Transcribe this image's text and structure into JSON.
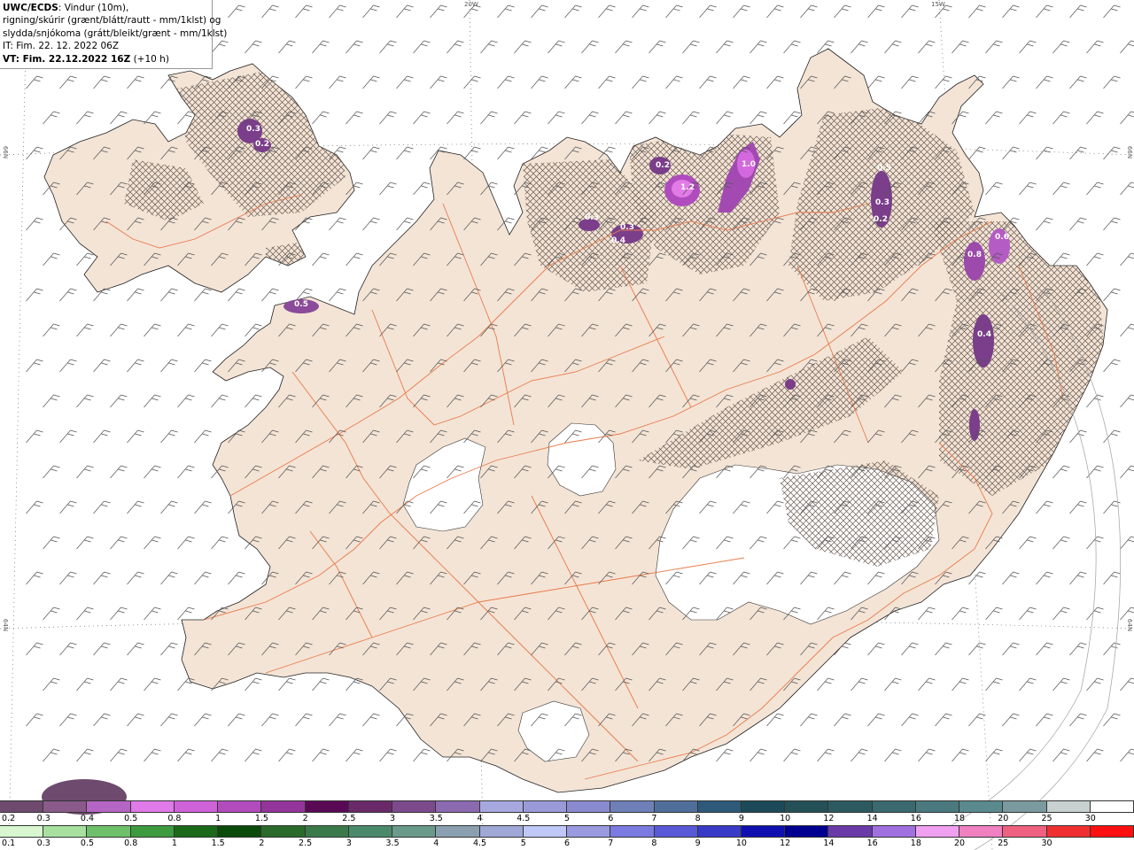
{
  "header": {
    "product": "UWC/ECDS",
    "line1_rest": ": Vindur (10m),",
    "line2": "rigning/skúrir (grænt/blátt/rautt - mm/1klst) og",
    "line3": "slydda/snjókoma (grátt/bleikt/grænt - mm/1klst)",
    "line4": "IT: Fim. 22. 12. 2022 06Z",
    "line5_bold": "VT: Fim. 22.12.2022 16Z",
    "line5_rest": " (+10 h)"
  },
  "grid_labels": {
    "lon_20w": "20W",
    "lon_15w": "15W",
    "lat_66n_left": "66N",
    "lat_66n_right": "66N",
    "lat_64n_left": "64N",
    "lat_64n_right": "64N"
  },
  "map_values": [
    "0.3",
    "0.2",
    "0.5",
    "0.3",
    "0.3",
    "0.4",
    "0.2",
    "1.2",
    "1.0",
    "0.5",
    "0.3",
    "0.2",
    "0.8",
    "0.6",
    "0.4"
  ],
  "legend": {
    "snow_labels": [
      "0.2",
      "0.3",
      "0.4",
      "0.5",
      "0.8",
      "1",
      "1.5",
      "2",
      "2.5",
      "3",
      "3.5",
      "4",
      "4.5",
      "5",
      "6",
      "7",
      "8",
      "9",
      "10",
      "12",
      "14",
      "16",
      "18",
      "20",
      "25",
      "30"
    ],
    "snow_colors": [
      "#6e4a6e",
      "#8a5a8a",
      "#b565c4",
      "#e07ae8",
      "#cf62d9",
      "#b24cbd",
      "#93359a",
      "#5a0a55",
      "#6a2a6a",
      "#7c4a8c",
      "#8c6ab0",
      "#a8a8e0",
      "#9a9ad8",
      "#8a8ad0",
      "#6f7fb8",
      "#4f6f9a",
      "#2d5a78",
      "#1d4a58",
      "#245058",
      "#2c5a60",
      "#3a6a70",
      "#4a7a80",
      "#5a8a8e",
      "#7a9a9e",
      "#c8d0d0",
      "#ffffff"
    ],
    "rain_labels": [
      "0.1",
      "0.3",
      "0.5",
      "0.8",
      "1",
      "1.5",
      "2",
      "2.5",
      "3",
      "3.5",
      "4",
      "4.5",
      "5",
      "6",
      "7",
      "8",
      "9",
      "10",
      "12",
      "14",
      "16",
      "18",
      "20",
      "25",
      "30"
    ],
    "rain_colors": [
      "#d8f7d0",
      "#a8e0a0",
      "#6fc06a",
      "#3e9a3e",
      "#1a6a1a",
      "#0a4a0a",
      "#2a6a2a",
      "#3a7a4a",
      "#4a8a6a",
      "#6a9a8a",
      "#8aa0b0",
      "#a0a8d8",
      "#c0c8f8",
      "#9a9ae0",
      "#7a7ae0",
      "#5a5ad8",
      "#3a3ac8",
      "#1010b0",
      "#000090",
      "#6a3aa8",
      "#a070e0",
      "#f0a0f0",
      "#f080c0",
      "#f06080",
      "#f03030",
      "#ff1010"
    ]
  }
}
